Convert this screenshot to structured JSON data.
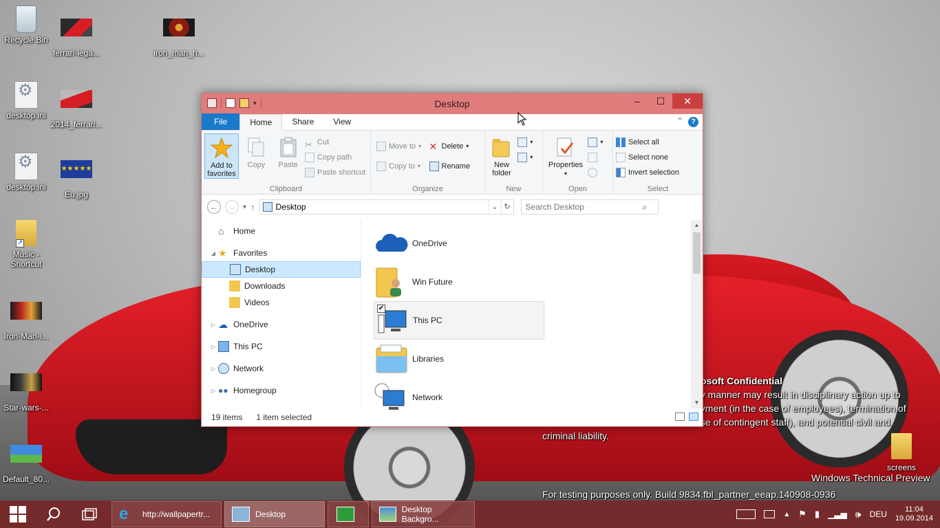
{
  "desktop": {
    "icons": [
      {
        "label": "Recycle Bin"
      },
      {
        "label": "ferrari-lega..."
      },
      {
        "label": "iron_man_h..."
      },
      {
        "label": "desktop.ini"
      },
      {
        "label": "2014_ferrari..."
      },
      {
        "label": "desktop.ini"
      },
      {
        "label": "Eu.jpg"
      },
      {
        "label": "Music - Shortcut"
      },
      {
        "label": "Iron-Man-i..."
      },
      {
        "label": "Star-wars-..."
      },
      {
        "label": "Default_80..."
      },
      {
        "label": "screens"
      }
    ]
  },
  "window": {
    "title": "Desktop",
    "tabs": {
      "file": "File",
      "home": "Home",
      "share": "Share",
      "view": "View"
    },
    "ribbon": {
      "clipboard": {
        "label": "Clipboard",
        "add_to_favorites": "Add to favorites",
        "copy": "Copy",
        "paste": "Paste",
        "cut": "Cut",
        "copy_path": "Copy path",
        "paste_shortcut": "Paste shortcut"
      },
      "organize": {
        "label": "Organize",
        "move_to": "Move to",
        "copy_to": "Copy to",
        "delete": "Delete",
        "rename": "Rename"
      },
      "new": {
        "label": "New",
        "new_folder": "New folder"
      },
      "open": {
        "label": "Open",
        "properties": "Properties"
      },
      "select": {
        "label": "Select",
        "select_all": "Select all",
        "select_none": "Select none",
        "invert_selection": "Invert selection"
      }
    },
    "address": {
      "path": "Desktop",
      "search_placeholder": "Search Desktop"
    },
    "nav": {
      "home": "Home",
      "favorites": "Favorites",
      "desktop": "Desktop",
      "downloads": "Downloads",
      "videos": "Videos",
      "onedrive": "OneDrive",
      "this_pc": "This PC",
      "network": "Network",
      "homegroup": "Homegroup"
    },
    "files": [
      {
        "name": "OneDrive"
      },
      {
        "name": "Win Future"
      },
      {
        "name": "This PC"
      },
      {
        "name": "Libraries"
      },
      {
        "name": "Network"
      }
    ],
    "status": {
      "items": "19 items",
      "selected": "1 item selected"
    }
  },
  "watermark": {
    "confidential_title": "osoft Confidential",
    "line1": "ny manner may result in disciplinary action up to",
    "line2": "oyment (in the case of employees), termination of",
    "line3": "ase of contingent staff), and potential civil and",
    "line4": "criminal liability.",
    "preview": "Windows Technical Preview",
    "build": "For testing purposes only. Build 9834.fbl_partner_eeap.140908-0936"
  },
  "taskbar": {
    "apps": [
      {
        "label": "http://wallpapertr..."
      },
      {
        "label": "Desktop"
      },
      {
        "label": ""
      },
      {
        "label": "Desktop Backgro..."
      }
    ],
    "language": "DEU",
    "time": "11:04",
    "date": "19.09.2014"
  },
  "colors": {
    "titlebar": "#e07c7c",
    "file_tab": "#1979ca",
    "taskbar": "#7a2626",
    "selection": "#cce8ff"
  }
}
